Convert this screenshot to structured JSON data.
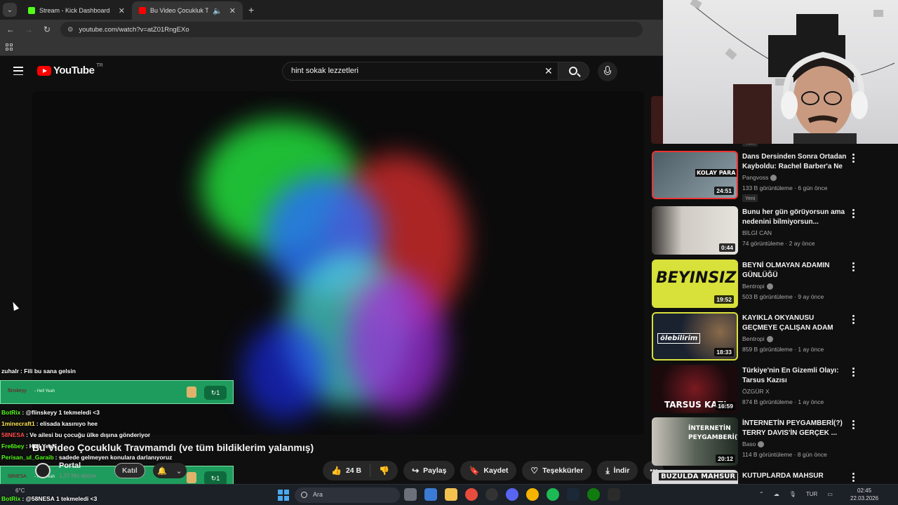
{
  "browser": {
    "tabs": [
      {
        "title": "Stream - Kick Dashboard",
        "favicon_color": "#53fc18",
        "active": false
      },
      {
        "title": "Bu Video Çocukluk Travmamdı",
        "favicon_color": "#ff0000",
        "active": true
      }
    ],
    "url": "youtube.com/watch?v=atZ01RngEXo"
  },
  "youtube": {
    "logo_text": "YouTube",
    "region": "TR",
    "search_value": "hint sokak lezzetleri"
  },
  "video": {
    "title": "Bu Video Çocukluk Travmamdı (ve tüm bildiklerim yalanmış)",
    "channel": "Portal",
    "subscribers": "1,37 Mn abone",
    "join_label": "Katıl",
    "likes": "24 B",
    "share_label": "Paylaş",
    "save_label": "Kaydet",
    "thanks_label": "Teşekkürler",
    "download_label": "İndir"
  },
  "chat": {
    "lines": [
      {
        "user": "zuhalr",
        "user_color": "#ffffff",
        "text": ": Fili bu sana gelsin"
      },
      {
        "user": "BotRix",
        "user_color": "#53fc18",
        "text": ": @flinskeyy 1 tekmeledi <3"
      },
      {
        "user": "1minecraft1",
        "user_color": "#ffe34f",
        "text": ": elisada kasınıyo hee"
      },
      {
        "user": "58NESA",
        "user_color": "#ff4d4d",
        "text": ": Ve ailesi bu çocuğu ülke dışına gönderiyor"
      },
      {
        "user": "Fre6bey",
        "user_color": "#53fc18",
        "text": ": Hell Yeah"
      },
      {
        "user": "Perisan_ul_Garaib",
        "user_color": "#53fc18",
        "text": ": sadede gelmeyen konulara darlanıyoruz"
      },
      {
        "user": "BotRix",
        "user_color": "#53fc18",
        "text": ": @58NESA 1 tekmeledi <3"
      }
    ],
    "alerts": [
      {
        "name": "flinskeyy",
        "message": "- Hell Yeah",
        "count": "1"
      },
      {
        "name": "58NESA",
        "message": "- Hell Yeah",
        "count": "1"
      }
    ]
  },
  "recommendations": [
    {
      "title": "Dans Dersinden Sonra Ortadan Kayboldu: Rachel Barber'a Ne ...",
      "channel": "Pangvoss",
      "verified": true,
      "meta": "133 B görüntüleme · 6 gün önce",
      "duration": "24:51",
      "new": "Yeni",
      "thumb_text": "KOLAY PARA TUZAKTI...",
      "thumb_color": "#6b7f8a"
    },
    {
      "title": "Bunu her gün görüyorsun ama nedenini bilmiyorsun...",
      "channel": "BİLGİ CAN",
      "verified": false,
      "meta": "74 görüntüleme · 2 ay önce",
      "duration": "0:44",
      "new": "",
      "thumb_text": "",
      "thumb_color": "#cfcac2"
    },
    {
      "title": "BEYNİ OLMAYAN ADAMIN GÜNLÜĞÜ",
      "channel": "Bentropi",
      "verified": true,
      "meta": "503 B görüntüleme · 9 ay önce",
      "duration": "19:52",
      "new": "",
      "thumb_text": "BEYINSIZ",
      "thumb_color": "#d8e03a"
    },
    {
      "title": "KAYIKLA OKYANUSU GEÇMEYE ÇALIŞAN ADAM",
      "channel": "Bentropi",
      "verified": true,
      "meta": "859 B görüntüleme · 1 ay önce",
      "duration": "18:33",
      "new": "",
      "thumb_text": "ölebilirim",
      "thumb_color": "#1a2230"
    },
    {
      "title": "Türkiye'nin En Gizemli Olayı: Tarsus Kazısı",
      "channel": "ÖZGÜR X",
      "verified": false,
      "meta": "874 B görüntüleme · 1 ay önce",
      "duration": "16:59",
      "new": "",
      "thumb_text": "TARSUS KAZI",
      "thumb_color": "#2a0d10"
    },
    {
      "title": "İNTERNETİN PEYGAMBERİ(?) TERRY DAVIS'İN GERÇEK ...",
      "channel": "Baso",
      "verified": true,
      "meta": "114 B görüntüleme · 8 gün önce",
      "duration": "20:12",
      "new": "",
      "thumb_text": "İNTERNETİN PEYGAMBERİ(?)",
      "thumb_color": "#2e3a2c"
    },
    {
      "title": "KUTUPLARDA MAHSUR",
      "channel": "",
      "verified": false,
      "meta": "",
      "duration": "",
      "new": "",
      "thumb_text": "BUZULDA MAHSUR",
      "thumb_color": "#d9d9d9"
    }
  ],
  "top_new_tag": "Yeni",
  "taskbar": {
    "weather": "6°C",
    "search_placeholder": "Ara",
    "lang": "TUR",
    "time": "02:45",
    "date": "22.03.2026"
  }
}
